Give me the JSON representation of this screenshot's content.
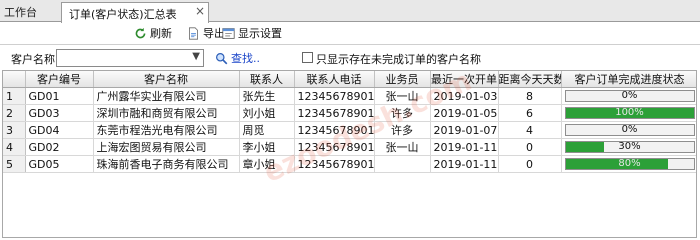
{
  "tabs": {
    "home_label": "工作台",
    "active_label": "订单(客户状态)汇总表",
    "close_glyph": "×"
  },
  "toolbar": {
    "refresh_label": "刷新",
    "export_label": "导出",
    "display_settings_label": "显示设置"
  },
  "filter": {
    "customer_name_label": "客户名称",
    "customer_name_value": "",
    "search_label": "查找..",
    "only_unfinished_label": "只显示存在未完成订单的客户名称",
    "only_unfinished_checked": false
  },
  "grid": {
    "columns": [
      "",
      "客户编号",
      "客户名称",
      "联系人",
      "联系人电话",
      "业务员",
      "最近一次开单",
      "距离今天天数",
      "客户订单完成进度状态"
    ],
    "rows": [
      {
        "num": "1",
        "code": "GD01",
        "name": "广州露华实业有限公司",
        "contact": "张先生",
        "phone": "12345678901",
        "salesman": "张一山",
        "last_order": "2019-01-03",
        "days": "8",
        "progress": 0,
        "progress_label": "0%"
      },
      {
        "num": "2",
        "code": "GD03",
        "name": "深圳市融和商贸有限公司",
        "contact": "刘小姐",
        "phone": "12345678901",
        "salesman": "许多",
        "last_order": "2019-01-05",
        "days": "6",
        "progress": 100,
        "progress_label": "100%"
      },
      {
        "num": "3",
        "code": "GD04",
        "name": "东莞市程浩光电有限公司",
        "contact": "周觅",
        "phone": "12345678901",
        "salesman": "许多",
        "last_order": "2019-01-07",
        "days": "4",
        "progress": 0,
        "progress_label": "0%"
      },
      {
        "num": "4",
        "code": "GD02",
        "name": "上海宏图贸易有限公司",
        "contact": "李小姐",
        "phone": "12345678901",
        "salesman": "张一山",
        "last_order": "2019-01-11",
        "days": "0",
        "progress": 30,
        "progress_label": "30%"
      },
      {
        "num": "5",
        "code": "GD05",
        "name": "珠海前香电子商务有限公司",
        "contact": "章小姐",
        "phone": "12345678901",
        "salesman": "",
        "last_order": "2019-01-11",
        "days": "0",
        "progress": 80,
        "progress_label": "80%"
      }
    ]
  },
  "colors": {
    "progress_fill": "#2ca038",
    "link": "#1a44c8"
  },
  "watermark": "ezoodesh.com"
}
